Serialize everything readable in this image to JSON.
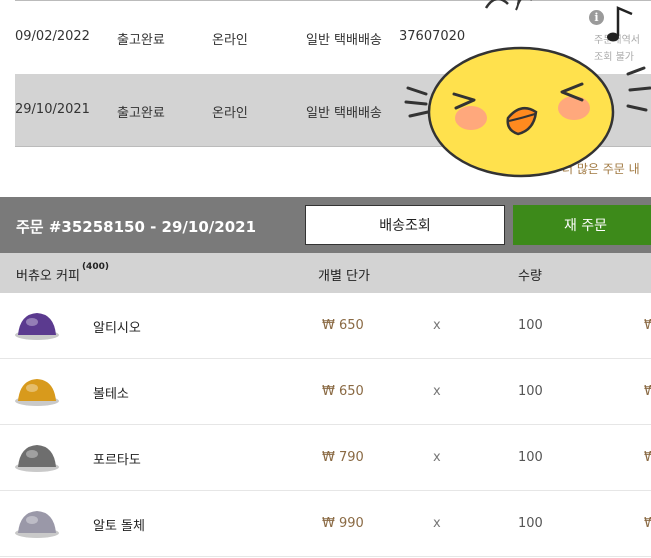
{
  "orders": [
    {
      "date": "09/02/2022",
      "status": "출고완료",
      "channel": "온라인",
      "delivery": "일반 택배배송",
      "tracking": "37607020"
    },
    {
      "date": "29/10/2021",
      "status": "출고완료",
      "channel": "온라인",
      "delivery": "일반 택배배송",
      "tracking": ""
    }
  ],
  "more_orders_label": "더 많은 주문 내",
  "info_note": [
    "주문내역서",
    "조회 불가"
  ],
  "order": {
    "title": "주문 #35258150 - 29/10/2021",
    "track_button": "배송조회",
    "reorder_button": "재 주문"
  },
  "table": {
    "col_product": "버츄오 커피",
    "product_count": "(400)",
    "col_unit_price": "개별 단가",
    "col_qty": "수량"
  },
  "items": [
    {
      "name": "알티시오",
      "price": "₩ 650",
      "times": "x",
      "qty": "100",
      "total": "₩",
      "color": "#5b3a8f"
    },
    {
      "name": "볼테소",
      "price": "₩ 650",
      "times": "x",
      "qty": "100",
      "total": "₩",
      "color": "#d89a1c"
    },
    {
      "name": "포르타도",
      "price": "₩ 790",
      "times": "x",
      "qty": "100",
      "total": "₩",
      "color": "#6e6e6e"
    },
    {
      "name": "알토 돌체",
      "price": "₩ 990",
      "times": "x",
      "qty": "100",
      "total": "₩",
      "color": "#9a98a8"
    }
  ],
  "colors": {
    "reorder": "#3d8a1a",
    "order_bar": "#7a7a7a",
    "price": "#8a6a44",
    "sticker": "#ffe14d"
  }
}
